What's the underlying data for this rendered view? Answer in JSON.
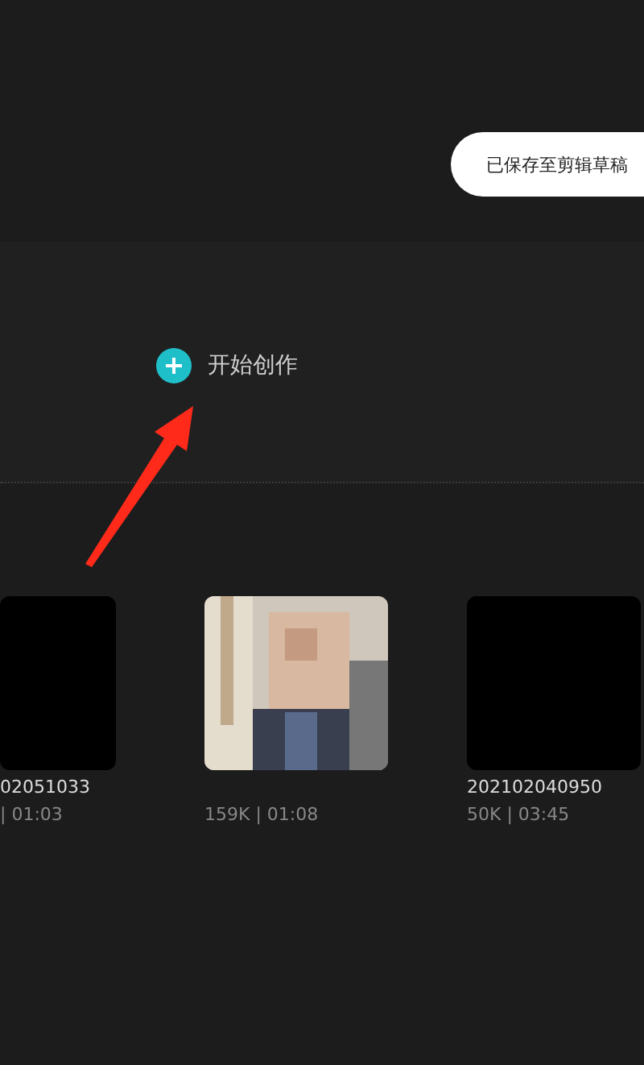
{
  "toast": {
    "text": "已保存至剪辑草稿"
  },
  "start_button": {
    "label": "开始创作"
  },
  "videos": [
    {
      "kind": "blank",
      "title": "02051033",
      "info": "| 01:03"
    },
    {
      "kind": "picture",
      "info": "159K | 01:08"
    },
    {
      "kind": "blank",
      "title": "202102040950",
      "info": "50K | 03:45"
    }
  ]
}
